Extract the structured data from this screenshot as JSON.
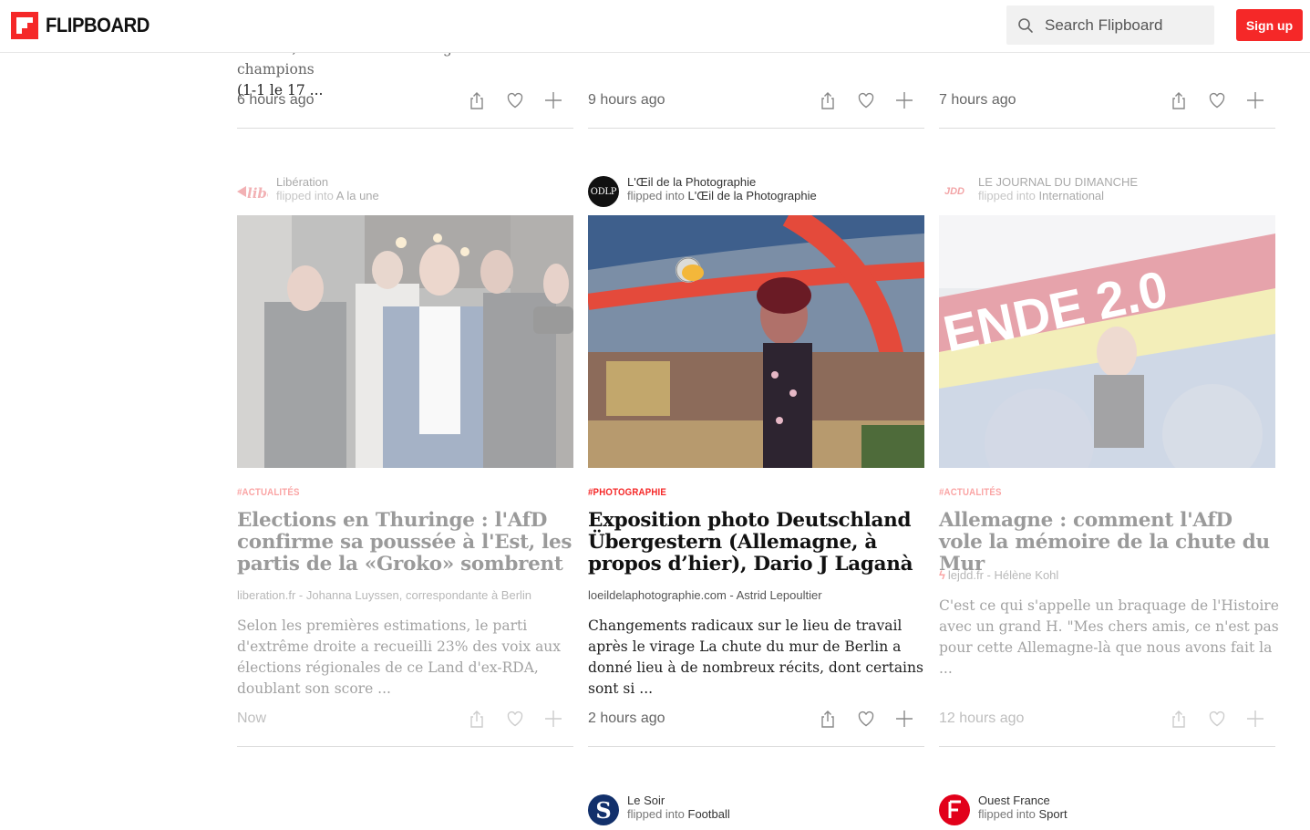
{
  "header": {
    "logo_text": "FLIPBOARD",
    "search_placeholder": "Search Flipboard",
    "signup_label": "Sign up",
    "accent_color": "#f52828"
  },
  "top_row": {
    "col1_snippet_line1": "Announ, ici contre l'OL en Ligue des champions",
    "col1_snippet_line2": "(1-1 le 17 ...",
    "col1_time": "6 hours ago",
    "col2_time": "9 hours ago",
    "col3_time": "7 hours ago"
  },
  "articles": [
    {
      "source": "Libération",
      "flipped_prefix": "flipped into ",
      "magazine": "A la une",
      "avatar_text": "libe",
      "tag": "#ACTUALITÉS",
      "headline": "Elections en Thuringe : l'AfD confirme sa poussée à l'Est, les partis de la «Groko» sombrent",
      "byline": "liberation.fr - Johanna Luyssen, correspondante à Berlin",
      "excerpt": "Selon les premières estimations, le parti d'extrême droite a recueilli 23% des voix aux élections régionales de ce Land d'ex-RDA, doublant son score ...",
      "time": "Now",
      "faded": true
    },
    {
      "source": "L'Œil de la Photographie",
      "flipped_prefix": "flipped into ",
      "magazine": "L'Œil de la Photographie",
      "avatar_text": "ODLP",
      "tag": "#PHOTOGRAPHIE",
      "headline": "Exposition photo Deutschland Übergestern (Allemagne, à propos d’hier), Dario J Laganà",
      "byline": "loeildelaphotographie.com - Astrid Lepoultier",
      "excerpt": "Changements radicaux sur le lieu de travail après le virage La chute du mur de Berlin a donné lieu à de nombreux récits, dont certains sont si ...",
      "time": "2 hours ago",
      "faded": false
    },
    {
      "source": "LE JOURNAL DU DIMANCHE",
      "flipped_prefix": "flipped into ",
      "magazine": "International",
      "avatar_text": "JDD",
      "tag": "#ACTUALITÉS",
      "headline": "Allemagne : comment l'AfD vole la mémoire de la chute du Mur",
      "byline": "lejdd.fr - Hélène Kohl",
      "excerpt": "C'est ce qui s'appelle un braquage de l'Histoire avec un grand H. \"Mes chers amis, ce n'est pas pour cette Allemagne-là que nous avons fait la ...",
      "time": "12 hours ago",
      "faded": true
    }
  ],
  "next_row": [
    {
      "source": "Le Soir",
      "flipped_prefix": "flipped into ",
      "magazine": "Football",
      "avatar_text": "S"
    },
    {
      "source": "Ouest France",
      "flipped_prefix": "flipped into ",
      "magazine": "Sport"
    }
  ]
}
